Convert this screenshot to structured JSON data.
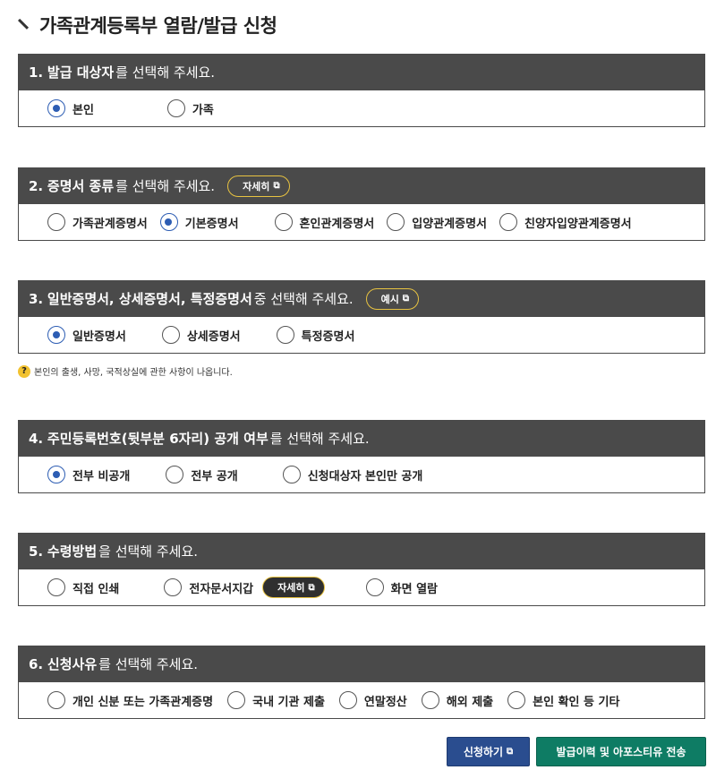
{
  "page": {
    "title": "가족관계등록부 열람/발급 신청"
  },
  "sections": [
    {
      "num": "1.",
      "em": "발급 대상자",
      "rest": "를 선택해 주세요.",
      "options": [
        {
          "label": "본인",
          "checked": true
        },
        {
          "label": "가족",
          "checked": false
        }
      ]
    },
    {
      "num": "2.",
      "em": "증명서 종류",
      "rest": "를 선택해 주세요.",
      "button": "자세히",
      "options": [
        {
          "label": "가족관계증명서",
          "checked": false
        },
        {
          "label": "기본증명서",
          "checked": true
        },
        {
          "label": "혼인관계증명서",
          "checked": false
        },
        {
          "label": "입양관계증명서",
          "checked": false
        },
        {
          "label": "친양자입양관계증명서",
          "checked": false
        }
      ]
    },
    {
      "num": "3.",
      "em": "일반증명서, 상세증명서, 특정증명서",
      "rest": " 중 선택해 주세요.",
      "button": "예시",
      "options": [
        {
          "label": "일반증명서",
          "checked": true
        },
        {
          "label": "상세증명서",
          "checked": false
        },
        {
          "label": "특정증명서",
          "checked": false
        }
      ]
    },
    {
      "num": "4.",
      "em": "주민등록번호(뒷부분 6자리) 공개 여부",
      "rest": "를 선택해 주세요.",
      "options": [
        {
          "label": "전부 비공개",
          "checked": true
        },
        {
          "label": "전부 공개",
          "checked": false
        },
        {
          "label": "신청대상자 본인만 공개",
          "checked": false
        }
      ]
    },
    {
      "num": "5.",
      "em": "수령방법",
      "rest": "을 선택해 주세요.",
      "inline_button": "자세히",
      "options": [
        {
          "label": "직접 인쇄",
          "checked": false
        },
        {
          "label": "전자문서지갑",
          "checked": false
        },
        {
          "label": "화면 열람",
          "checked": false
        }
      ]
    },
    {
      "num": "6.",
      "em": "신청사유",
      "rest": "를 선택해 주세요.",
      "options": [
        {
          "label": "개인 신분 또는 가족관계증명",
          "checked": false
        },
        {
          "label": "국내 기관 제출",
          "checked": false
        },
        {
          "label": "연말정산",
          "checked": false
        },
        {
          "label": "해외 제출",
          "checked": false
        },
        {
          "label": "본인 확인 등 기타",
          "checked": false
        }
      ]
    }
  ],
  "help_note": "본인의 출생, 사망, 국적상실에 관한 사항이 나옵니다.",
  "actions": {
    "apply": "신청하기",
    "history": "발급이력 및 아포스티유 전송"
  },
  "colors": {
    "header_bg": "#4a4a4a",
    "radio_checked": "#2d5db3",
    "apply_btn": "#2a4d8f",
    "history_btn": "#0e7c64",
    "pill_border": "#e8c341"
  }
}
